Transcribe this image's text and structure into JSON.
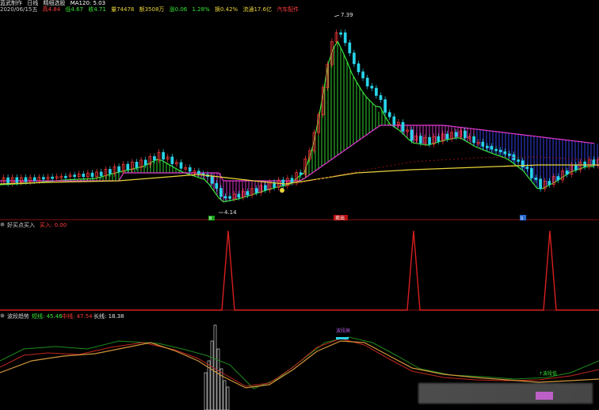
{
  "header": {
    "name": "蓝武制作",
    "period": "日线",
    "indicator_name": "精细选股",
    "ma_label": "MA120: 5.03",
    "line2_date": "2020/06/15五",
    "ma_values": [
      "高4.84",
      "低4.67",
      "收4.71",
      "量74478",
      "额3508万",
      "涨0.06",
      "1.28%",
      "换0.42%",
      "流通17.6亿",
      "汽车配件"
    ]
  },
  "price_panel": {
    "annot_high": "7.39",
    "annot_low": "4.14",
    "marker_left": "B",
    "marker_mid": "卖出",
    "marker_right": "S"
  },
  "signal_panel": {
    "title": "好买点买入",
    "legend": "买入: 0.00"
  },
  "osc_panel": {
    "title": "波段趋势",
    "legend_a": "短线: 45.46",
    "legend_b": "中线: 47.54",
    "legend_c": "长线: 18.38",
    "tag_top": "波段高",
    "tag_right": "↑波段低"
  },
  "colors": {
    "up": "#ff3b3b",
    "down": "#29d3e8",
    "green_band": "#37e637",
    "magenta_band": "#e43ad4",
    "blue_band": "#3b48ff",
    "ma_yellow": "#e8d23a",
    "signal_red": "#d81f1f"
  },
  "icons": [
    "fold-icon",
    "fold-icon",
    "fold-icon"
  ]
}
